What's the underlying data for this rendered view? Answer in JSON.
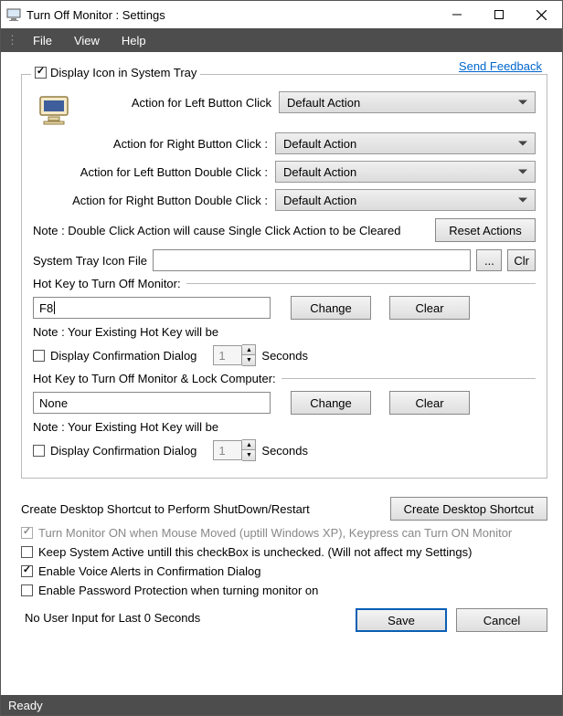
{
  "titlebar": {
    "text": "Turn Off Monitor : Settings"
  },
  "menubar": {
    "file": "File",
    "view": "View",
    "help": "Help"
  },
  "feedback_link": "Send Feedback",
  "tray": {
    "checkbox_label": "Display Icon in System Tray",
    "left_click_label": "Action for Left Button Click",
    "right_click_label": "Action for Right Button Click :",
    "left_dbl_label": "Action for Left Button Double Click :",
    "right_dbl_label": "Action for Right Button Double Click :",
    "default_action": "Default Action",
    "note_double": "Note : Double Click Action will cause Single Click Action to be Cleared",
    "reset_btn": "Reset Actions",
    "tray_file_label": "System Tray Icon File",
    "tray_file_value": "",
    "browse_btn": "...",
    "clr_btn": "Clr"
  },
  "hotkey1": {
    "section_label": "Hot Key to Turn Off Monitor:",
    "value": "F8",
    "change_btn": "Change",
    "clear_btn": "Clear",
    "note": "Note : Your Existing Hot Key will be",
    "confirm_label": "Display Confirmation Dialog",
    "confirm_seconds": "1",
    "seconds_label": "Seconds"
  },
  "hotkey2": {
    "section_label": "Hot Key to Turn Off Monitor & Lock Computer:",
    "value": "None",
    "change_btn": "Change",
    "clear_btn": "Clear",
    "note": "Note : Your Existing Hot Key will be",
    "confirm_label": "Display Confirmation Dialog",
    "confirm_seconds": "1",
    "seconds_label": "Seconds"
  },
  "shortcut": {
    "label": "Create Desktop Shortcut to Perform ShutDown/Restart",
    "btn": "Create Desktop Shortcut"
  },
  "opts": {
    "mouse_on": "Turn Monitor ON when Mouse Moved (uptill Windows XP), Keypress can Turn ON Monitor",
    "keep_active": "Keep System Active untill this checkBox is unchecked.  (Will not affect my Settings)",
    "voice_alerts": "Enable Voice Alerts in Confirmation Dialog",
    "password_prot": "Enable Password Protection when turning monitor on",
    "no_input": "No User Input for Last 0 Seconds"
  },
  "footer": {
    "save": "Save",
    "cancel": "Cancel"
  },
  "statusbar": {
    "text": "Ready"
  }
}
